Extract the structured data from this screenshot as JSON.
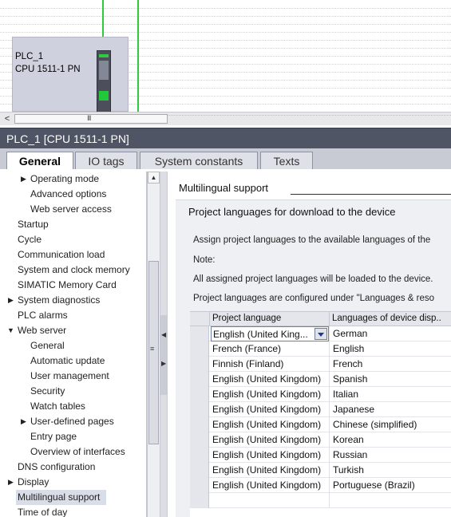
{
  "device": {
    "name": "PLC_1",
    "type": "CPU 1511-1 PN"
  },
  "inspector": {
    "title": "PLC_1 [CPU 1511-1 PN]"
  },
  "tabs": [
    {
      "label": "General",
      "active": true
    },
    {
      "label": "IO tags",
      "active": false
    },
    {
      "label": "System constants",
      "active": false
    },
    {
      "label": "Texts",
      "active": false
    }
  ],
  "nav": {
    "items": [
      {
        "label": "Operating mode"
      },
      {
        "label": "Advanced options"
      },
      {
        "label": "Web server access"
      },
      {
        "label": "Startup"
      },
      {
        "label": "Cycle"
      },
      {
        "label": "Communication load"
      },
      {
        "label": "System and clock memory"
      },
      {
        "label": "SIMATIC Memory Card"
      },
      {
        "label": "System diagnostics"
      },
      {
        "label": "PLC alarms"
      },
      {
        "label": "Web server"
      },
      {
        "label": "General"
      },
      {
        "label": "Automatic update"
      },
      {
        "label": "User management"
      },
      {
        "label": "Security"
      },
      {
        "label": "Watch tables"
      },
      {
        "label": "User-defined pages"
      },
      {
        "label": "Entry page"
      },
      {
        "label": "Overview of interfaces"
      },
      {
        "label": "DNS configuration"
      },
      {
        "label": "Display"
      },
      {
        "label": "Multilingual support"
      },
      {
        "label": "Time of day"
      }
    ]
  },
  "content": {
    "section_title": "Multilingual support",
    "panel_title": "Project languages for download to the device",
    "info_lines": [
      "Assign project languages to the available languages of the",
      "Note:",
      "All assigned project languages will be loaded to the device.",
      "Project languages are configured under \"Languages & reso"
    ],
    "table": {
      "headers": [
        "Project language",
        "Languages of device disp.."
      ],
      "rows": [
        [
          "English (United King...",
          "German"
        ],
        [
          "French (France)",
          "English"
        ],
        [
          "Finnish (Finland)",
          "French"
        ],
        [
          "English (United Kingdom)",
          "Spanish"
        ],
        [
          "English (United Kingdom)",
          "Italian"
        ],
        [
          "English (United Kingdom)",
          "Japanese"
        ],
        [
          "English (United Kingdom)",
          "Chinese (simplified)"
        ],
        [
          "English (United Kingdom)",
          "Korean"
        ],
        [
          "English (United Kingdom)",
          "Russian"
        ],
        [
          "English (United Kingdom)",
          "Turkish"
        ],
        [
          "English (United Kingdom)",
          "Portuguese (Brazil)"
        ],
        [
          "",
          ""
        ]
      ]
    }
  },
  "scroll": {
    "grip_glyph": "III"
  },
  "colors": {
    "header_bg": "#4f5564",
    "connection_line": "#2fcb3d",
    "device_bg": "#cfd1de",
    "selected_bg": "#d8dde8"
  }
}
